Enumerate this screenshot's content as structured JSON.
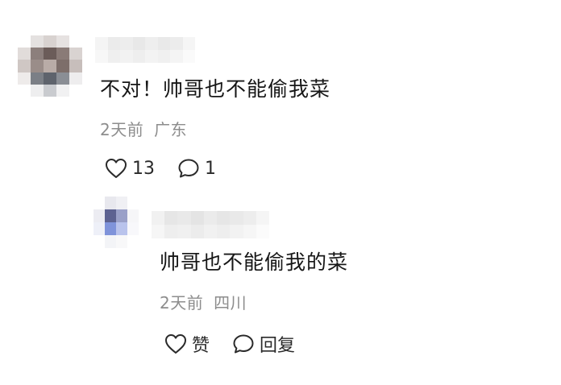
{
  "comment": {
    "text": "不对！帅哥也不能偷我菜",
    "time": "2天前",
    "location": "广东",
    "likes": "13",
    "replies": "1"
  },
  "reply": {
    "text": "帅哥也不能偷我的菜",
    "time": "2天前",
    "location": "四川",
    "like_label": "赞",
    "reply_label": "回复"
  },
  "icons": {
    "like": "heart-outline-icon",
    "comment": "speech-bubble-icon"
  },
  "colors": {
    "text": "#161616",
    "meta": "#8d8d8d",
    "icon": "#2a2a2a"
  }
}
